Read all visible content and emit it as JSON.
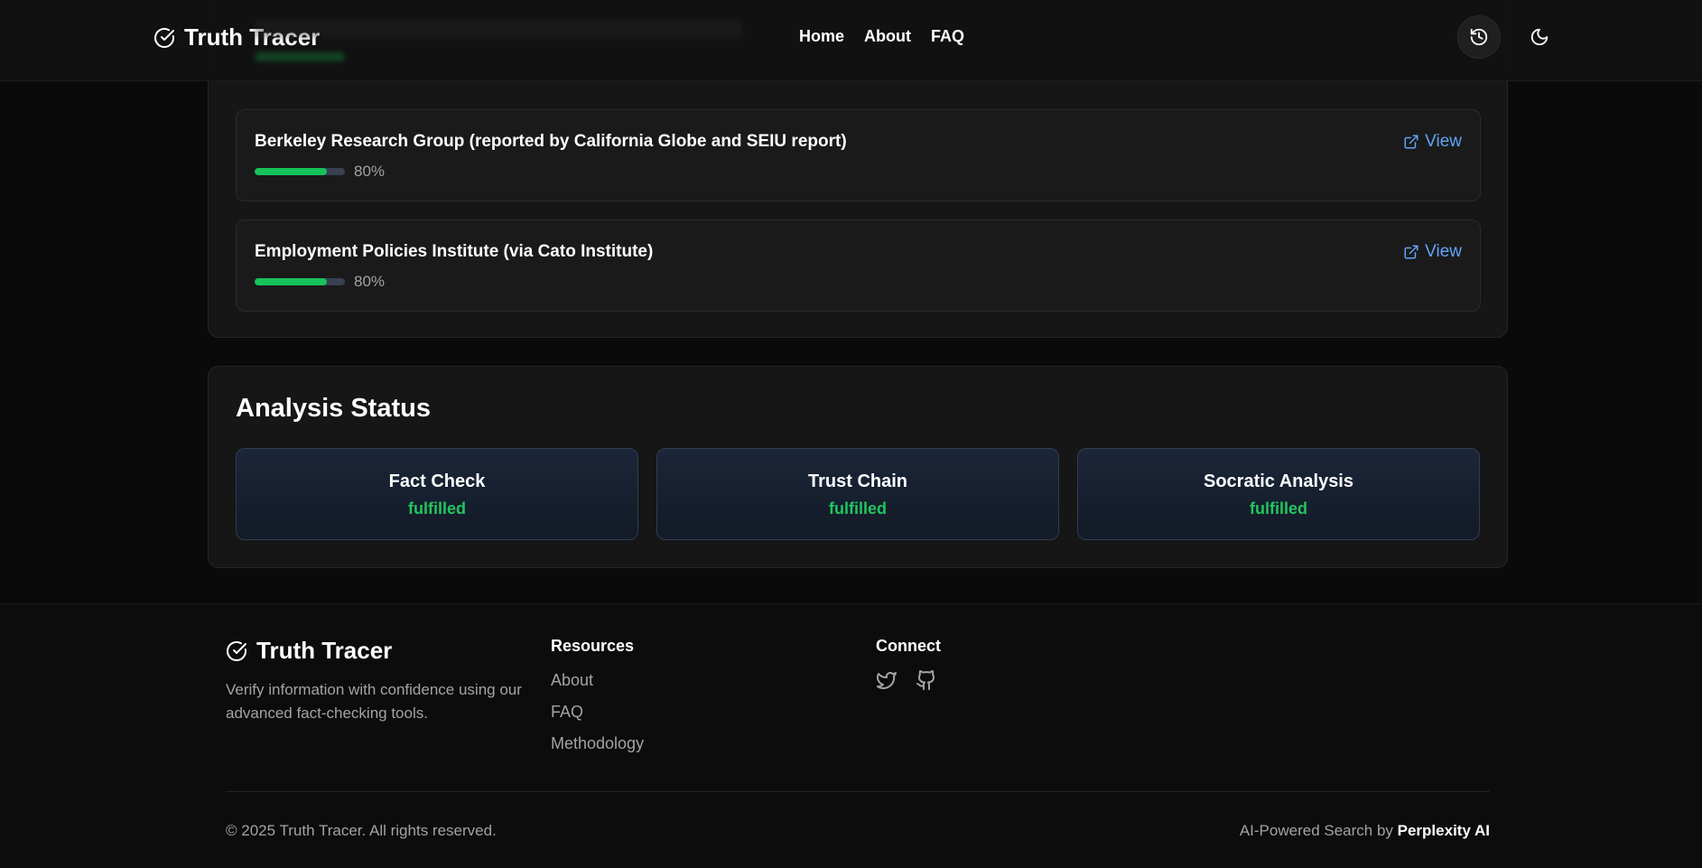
{
  "header": {
    "brand": "Truth Tracer",
    "nav": [
      {
        "label": "Home"
      },
      {
        "label": "About"
      },
      {
        "label": "FAQ"
      }
    ]
  },
  "sources": [
    {
      "title": "Berkeley Research Group (reported by California Globe and SEIU report)",
      "confidence": 0.8,
      "confidence_label": "80%",
      "link_label": "View"
    },
    {
      "title": "Employment Policies Institute (via Cato Institute)",
      "confidence": 0.8,
      "confidence_label": "80%",
      "link_label": "View"
    }
  ],
  "analysis_status": {
    "title": "Analysis Status",
    "items": [
      {
        "name": "Fact Check",
        "state": "fulfilled"
      },
      {
        "name": "Trust Chain",
        "state": "fulfilled"
      },
      {
        "name": "Socratic Analysis",
        "state": "fulfilled"
      }
    ]
  },
  "footer": {
    "brand": "Truth Tracer",
    "description": "Verify information with confidence using our advanced fact-checking tools.",
    "resources_title": "Resources",
    "resources": [
      {
        "label": "About"
      },
      {
        "label": "FAQ"
      },
      {
        "label": "Methodology"
      }
    ],
    "connect_title": "Connect",
    "social": [
      "twitter-icon",
      "github-icon"
    ],
    "copyright": "© 2025 Truth Tracer. All rights reserved.",
    "powered_prefix": "AI-Powered Search by",
    "powered_brand": "Perplexity AI"
  },
  "colors": {
    "accent_green": "#22c55e",
    "link_blue": "#60a5fa",
    "background": "#0a0a0a"
  }
}
